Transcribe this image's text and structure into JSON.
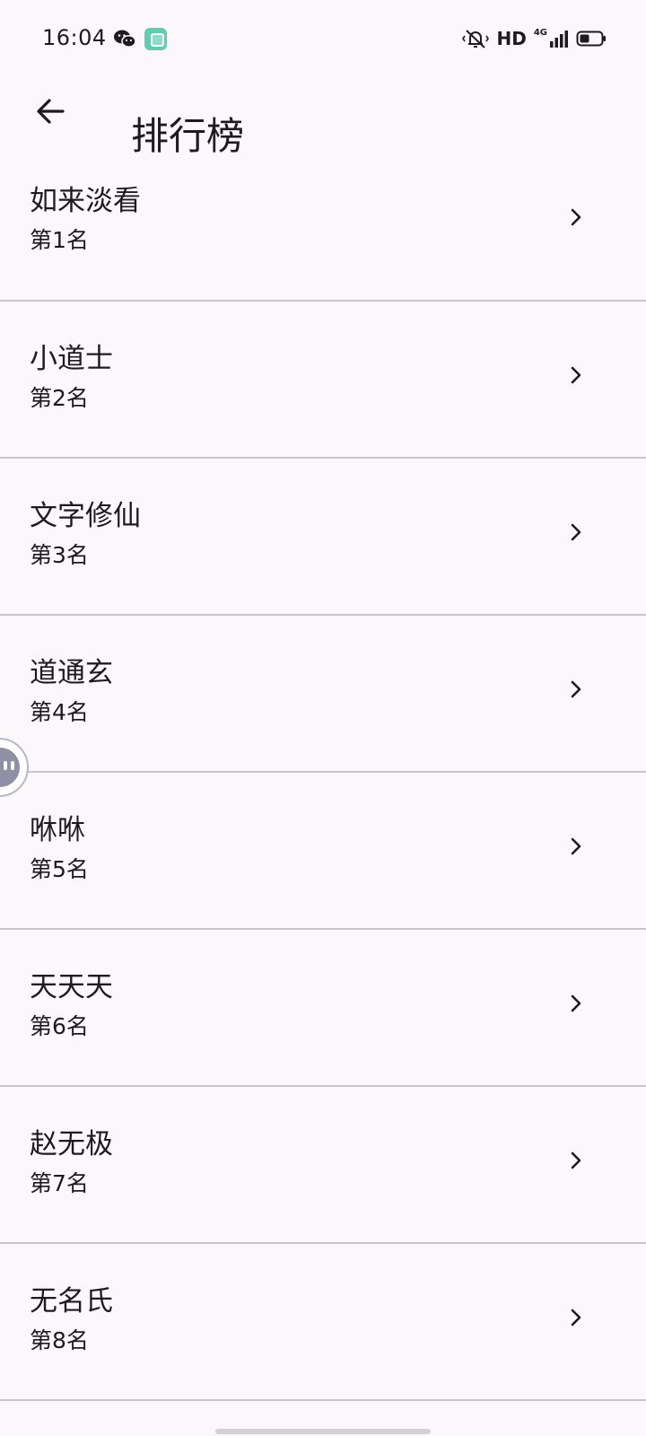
{
  "status_bar": {
    "time": "16:04",
    "network_label": "4G",
    "hd_label": "HD",
    "icons": [
      "wechat-icon",
      "app-notification-icon",
      "vibrate-silent-icon",
      "signal-icon",
      "battery-icon"
    ]
  },
  "app_bar": {
    "back_icon": "arrow-back-icon",
    "title": "排行榜"
  },
  "ranking": {
    "items": [
      {
        "name": "如来淡看",
        "position": "第1名"
      },
      {
        "name": "小道士",
        "position": "第2名"
      },
      {
        "name": "文字修仙",
        "position": "第3名"
      },
      {
        "name": "道通玄",
        "position": "第4名"
      },
      {
        "name": "咻咻",
        "position": "第5名"
      },
      {
        "name": "天天天",
        "position": "第6名"
      },
      {
        "name": "赵无极",
        "position": "第7名"
      },
      {
        "name": "无名氏",
        "position": "第8名"
      }
    ],
    "chevron_icon": "chevron-right-icon"
  },
  "colors": {
    "background": "#FCF7FB",
    "text": "#1C1B1F",
    "divider": "#C9C5CB"
  }
}
